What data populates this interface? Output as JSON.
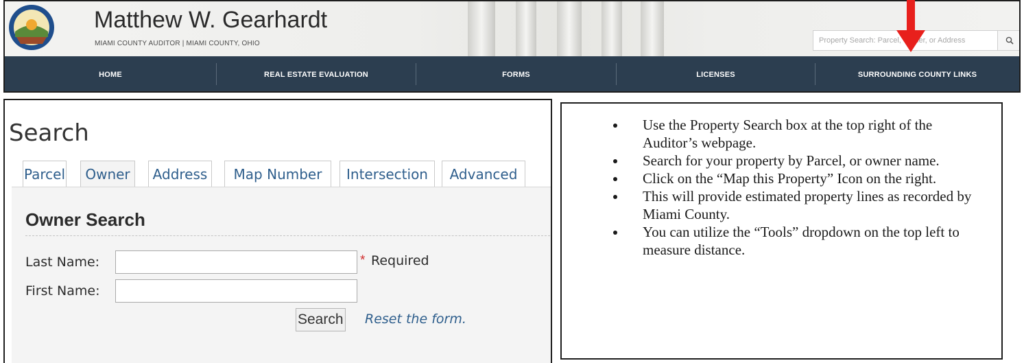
{
  "header": {
    "title": "Matthew W. Gearhardt",
    "subtitle": "MIAMI COUNTY AUDITOR | MIAMI COUNTY, OHIO",
    "search": {
      "placeholder": "Property Search: Parcel, Owner, or Address",
      "value": ""
    },
    "seal_icon": "county-seal-icon",
    "search_icon": "magnifier-icon"
  },
  "nav": {
    "items": [
      {
        "label": "HOME"
      },
      {
        "label": "REAL ESTATE EVALUATION"
      },
      {
        "label": "FORMS"
      },
      {
        "label": "LICENSES"
      },
      {
        "label": "SURROUNDING COUNTY LINKS"
      }
    ]
  },
  "annotation": {
    "arrow_icon": "red-down-arrow-icon",
    "arrow_color": "#e8201c"
  },
  "search_page": {
    "title": "Search",
    "tabs": [
      {
        "label": "Parcel"
      },
      {
        "label": "Owner"
      },
      {
        "label": "Address"
      },
      {
        "label": "Map Number"
      },
      {
        "label": "Intersection"
      },
      {
        "label": "Advanced"
      }
    ],
    "active_tab": "Owner",
    "form": {
      "heading": "Owner Search",
      "last_name_label": "Last Name:",
      "last_name_value": "",
      "required_text": "Required",
      "first_name_label": "First Name:",
      "first_name_value": "",
      "submit_label": "Search",
      "reset_label": "Reset the form."
    }
  },
  "instructions": [
    "Use the Property Search box at the top right of the Auditor’s webpage.",
    "Search for your property by Parcel, or owner name.",
    "Click on the “Map this Property” Icon on the right.",
    "This will provide estimated property lines as recorded by Miami County.",
    "You can utilize the “Tools” dropdown on the top left to measure distance."
  ],
  "colors": {
    "nav_bg": "#2c3e50",
    "link": "#2e5e8c",
    "required": "#d02b2b"
  }
}
